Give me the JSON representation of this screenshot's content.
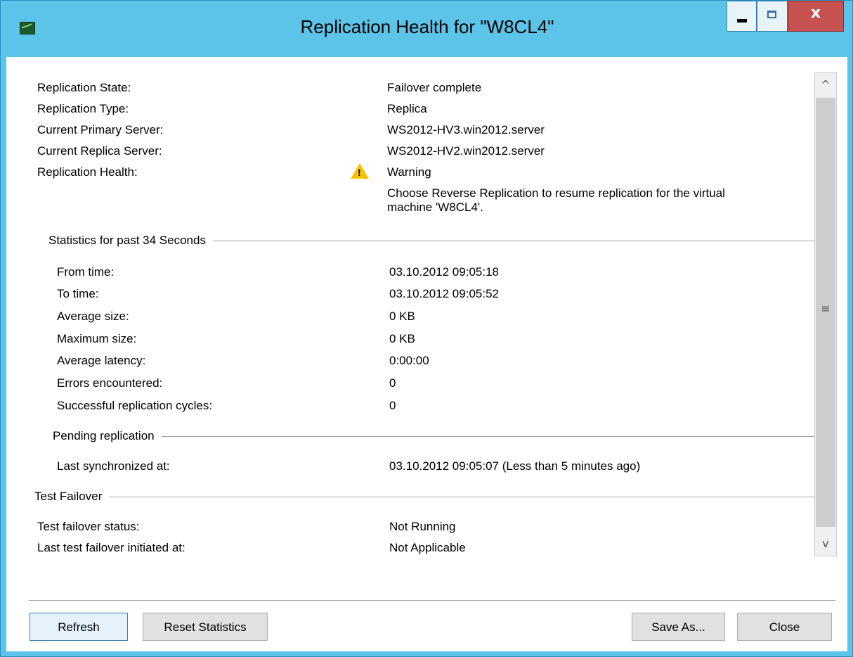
{
  "window": {
    "title": "Replication Health for \"W8CL4\"",
    "close_glyph": "x"
  },
  "summary": [
    {
      "label": "Replication State:",
      "value": "Failover complete"
    },
    {
      "label": "Replication Type:",
      "value": "Replica"
    },
    {
      "label": "Current Primary Server:",
      "value": "WS2012-HV3.win2012.server"
    },
    {
      "label": "Current Replica Server:",
      "value": "WS2012-HV2.win2012.server"
    },
    {
      "label": "Replication Health:",
      "value": "Warning"
    }
  ],
  "health_message_line1": "Choose Reverse Replication to resume replication for the virtual",
  "health_message_line2": "machine 'W8CL4'.",
  "health_icon": "warning-icon",
  "statistics": {
    "title": "Statistics for past 34 Seconds",
    "rows": [
      {
        "label": "From time:",
        "value": "03.10.2012 09:05:18"
      },
      {
        "label": "To time:",
        "value": "03.10.2012 09:05:52"
      },
      {
        "label": "Average size:",
        "value": "0 KB"
      },
      {
        "label": "Maximum size:",
        "value": "0 KB"
      },
      {
        "label": "Average latency:",
        "value": "0:00:00"
      },
      {
        "label": "Errors encountered:",
        "value": "0"
      },
      {
        "label": "Successful replication cycles:",
        "value": "0"
      }
    ]
  },
  "pending": {
    "title": "Pending replication",
    "rows": [
      {
        "label": "Last synchronized at:",
        "value": "03.10.2012 09:05:07 (Less than 5 minutes ago)"
      }
    ]
  },
  "test_failover": {
    "title": "Test Failover",
    "rows": [
      {
        "label": "Test failover status:",
        "value": "Not Running"
      },
      {
        "label": "Last test failover initiated at:",
        "value": "Not Applicable"
      }
    ]
  },
  "buttons": {
    "refresh": "Refresh",
    "reset": "Reset Statistics",
    "save_as": "Save As...",
    "close": "Close"
  },
  "scrollbar": {
    "up": "^",
    "down": "v",
    "grip": "≡"
  }
}
